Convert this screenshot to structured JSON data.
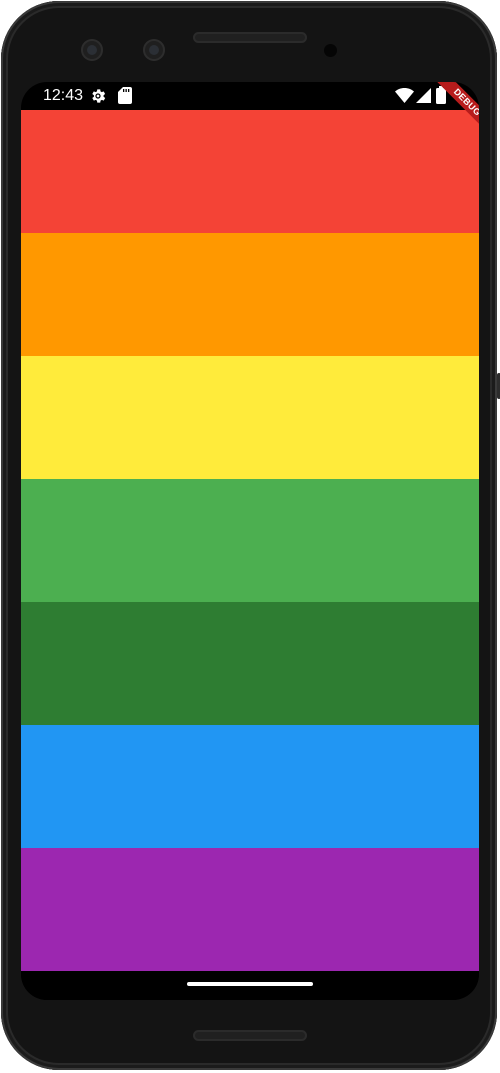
{
  "status_bar": {
    "time": "12:43",
    "left_icons": [
      "settings-gear-icon",
      "sd-card-icon"
    ],
    "right_icons": [
      "wifi-icon",
      "cellular-signal-icon",
      "battery-icon"
    ]
  },
  "debug_banner": {
    "label": "DEBUG",
    "color": "#B71C1C"
  },
  "stripes": [
    {
      "color": "#F44336"
    },
    {
      "color": "#FF9800"
    },
    {
      "color": "#FFEB3B"
    },
    {
      "color": "#4CAF50"
    },
    {
      "color": "#2E7D32"
    },
    {
      "color": "#2196F3"
    },
    {
      "color": "#9C27B0"
    }
  ],
  "device": {
    "frame_color": "#141414",
    "nav_handle_color": "#FFFFFF"
  }
}
